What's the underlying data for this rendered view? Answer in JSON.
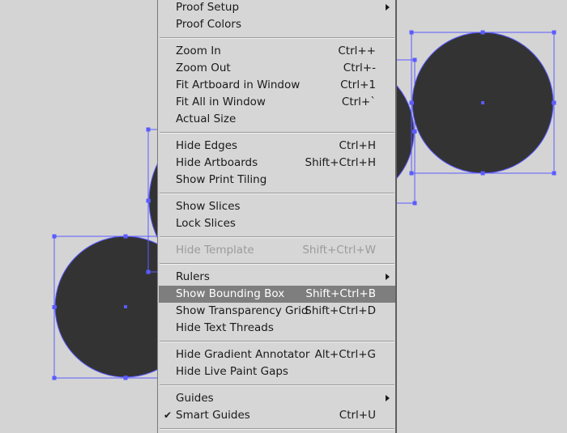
{
  "menu": {
    "items": [
      {
        "label": "Proof Setup",
        "shortcut": "",
        "submenu": true,
        "enabled": true,
        "checked": false
      },
      {
        "label": "Proof Colors",
        "shortcut": "",
        "submenu": false,
        "enabled": true,
        "checked": false
      },
      {
        "label": "Zoom In",
        "shortcut": "Ctrl++",
        "submenu": false,
        "enabled": true,
        "checked": false
      },
      {
        "label": "Zoom Out",
        "shortcut": "Ctrl+-",
        "submenu": false,
        "enabled": true,
        "checked": false
      },
      {
        "label": "Fit Artboard in Window",
        "shortcut": "Ctrl+1",
        "submenu": false,
        "enabled": true,
        "checked": false
      },
      {
        "label": "Fit All in Window",
        "shortcut": "Ctrl+`",
        "submenu": false,
        "enabled": true,
        "checked": false
      },
      {
        "label": "Actual Size",
        "shortcut": "",
        "submenu": false,
        "enabled": true,
        "checked": false
      },
      {
        "label": "Hide Edges",
        "shortcut": "Ctrl+H",
        "submenu": false,
        "enabled": true,
        "checked": false
      },
      {
        "label": "Hide Artboards",
        "shortcut": "Shift+Ctrl+H",
        "submenu": false,
        "enabled": true,
        "checked": false
      },
      {
        "label": "Show Print Tiling",
        "shortcut": "",
        "submenu": false,
        "enabled": true,
        "checked": false
      },
      {
        "label": "Show Slices",
        "shortcut": "",
        "submenu": false,
        "enabled": true,
        "checked": false
      },
      {
        "label": "Lock Slices",
        "shortcut": "",
        "submenu": false,
        "enabled": true,
        "checked": false
      },
      {
        "label": "Hide Template",
        "shortcut": "Shift+Ctrl+W",
        "submenu": false,
        "enabled": false,
        "checked": false
      },
      {
        "label": "Rulers",
        "shortcut": "",
        "submenu": true,
        "enabled": true,
        "checked": false
      },
      {
        "label": "Show Bounding Box",
        "shortcut": "Shift+Ctrl+B",
        "submenu": false,
        "enabled": true,
        "checked": false,
        "highlighted": true
      },
      {
        "label": "Show Transparency Grid",
        "shortcut": "Shift+Ctrl+D",
        "submenu": false,
        "enabled": true,
        "checked": false
      },
      {
        "label": "Hide Text Threads",
        "shortcut": "",
        "submenu": false,
        "enabled": true,
        "checked": false
      },
      {
        "label": "Hide Gradient Annotator",
        "shortcut": "Alt+Ctrl+G",
        "submenu": false,
        "enabled": true,
        "checked": false
      },
      {
        "label": "Hide Live Paint Gaps",
        "shortcut": "",
        "submenu": false,
        "enabled": true,
        "checked": false
      },
      {
        "label": "Guides",
        "shortcut": "",
        "submenu": true,
        "enabled": true,
        "checked": false
      },
      {
        "label": "Smart Guides",
        "shortcut": "Ctrl+U",
        "submenu": false,
        "enabled": true,
        "checked": true
      }
    ],
    "check_glyph": "✔"
  },
  "colors": {
    "canvas_bg": "#d4d4d4",
    "shape_fill": "#333333",
    "selection": "#5b5bff",
    "menu_bg": "#d6d6d6",
    "highlight_bg": "#7e7e7e",
    "disabled_text": "#9b9b9b"
  },
  "icons": {
    "submenu": "chevron-right-icon",
    "check": "check-icon"
  }
}
